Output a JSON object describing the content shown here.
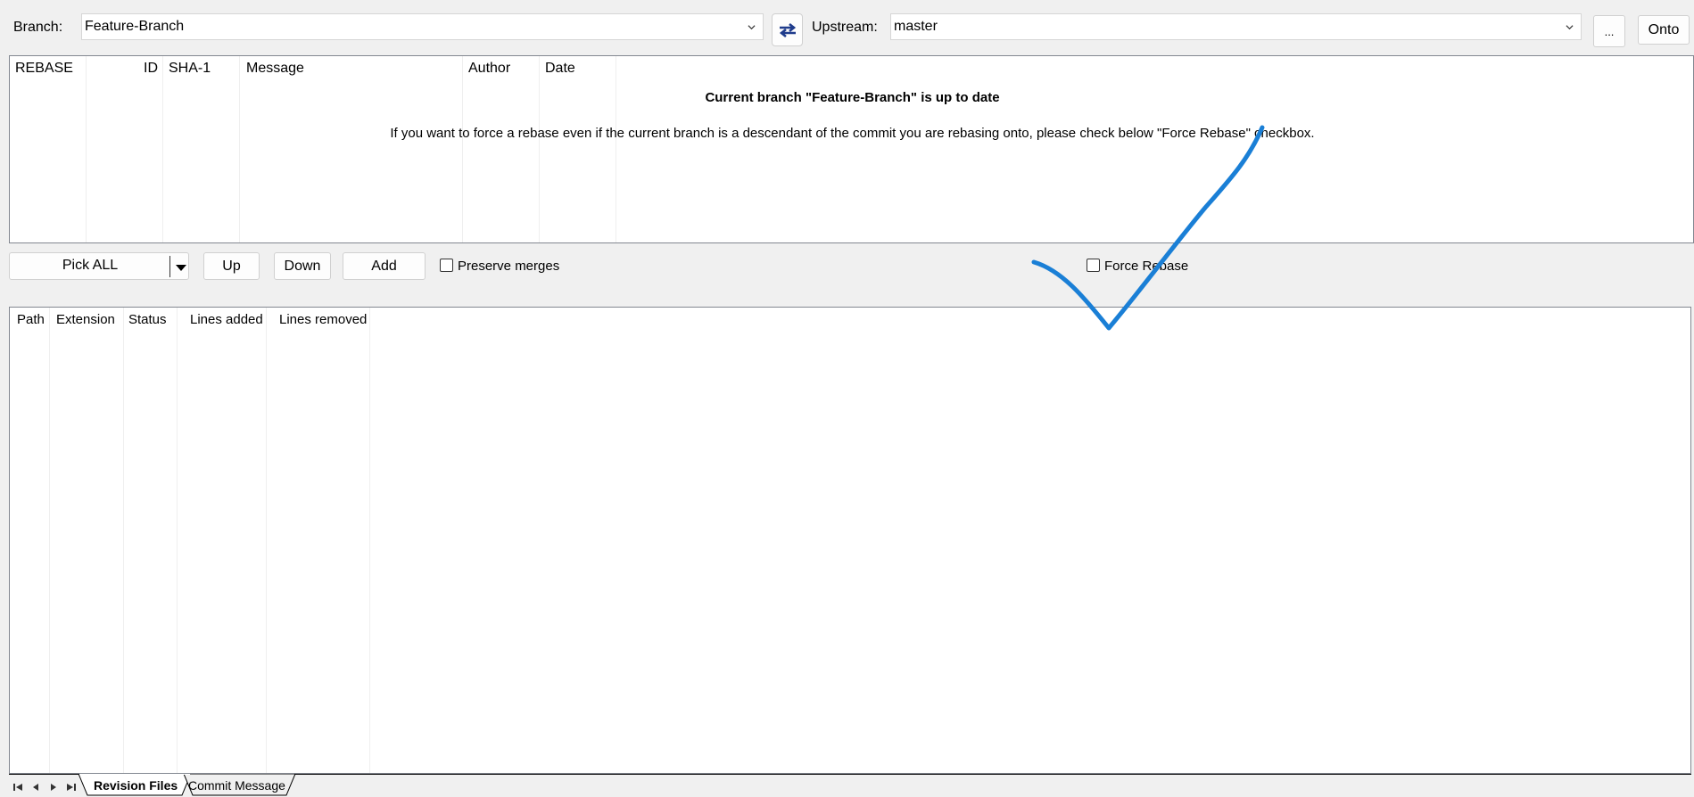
{
  "toolbar": {
    "branch_label": "Branch:",
    "branch_value": "Feature-Branch",
    "upstream_label": "Upstream:",
    "upstream_value": "master",
    "browse_label": "...",
    "onto_label": "Onto"
  },
  "commits_grid": {
    "columns": [
      "REBASE",
      "ID",
      "SHA-1",
      "Message",
      "Author",
      "Date"
    ],
    "status_title": "Current branch \"Feature-Branch\" is up to date",
    "status_message": "If you want to force a rebase even if the current branch is a descendant of the commit you are rebasing onto, please check below \"Force Rebase\" checkbox."
  },
  "actions": {
    "pick_all_label": "Pick ALL",
    "up_label": "Up",
    "down_label": "Down",
    "add_label": "Add",
    "preserve_merges_label": "Preserve merges",
    "preserve_merges_checked": false,
    "force_rebase_label": "Force Rebase",
    "force_rebase_checked": false
  },
  "files_grid": {
    "columns": [
      "Path",
      "Extension",
      "Status",
      "Lines added",
      "Lines removed"
    ]
  },
  "tabs": {
    "items": [
      {
        "label": "Revision Files",
        "active": true
      },
      {
        "label": "Commit Message",
        "active": false
      }
    ]
  },
  "annotation": {
    "color": "#1a7fd6",
    "shape": "checkmark"
  },
  "colors": {
    "swap_icon": "#1f3c8c",
    "grid_border": "#828790"
  }
}
